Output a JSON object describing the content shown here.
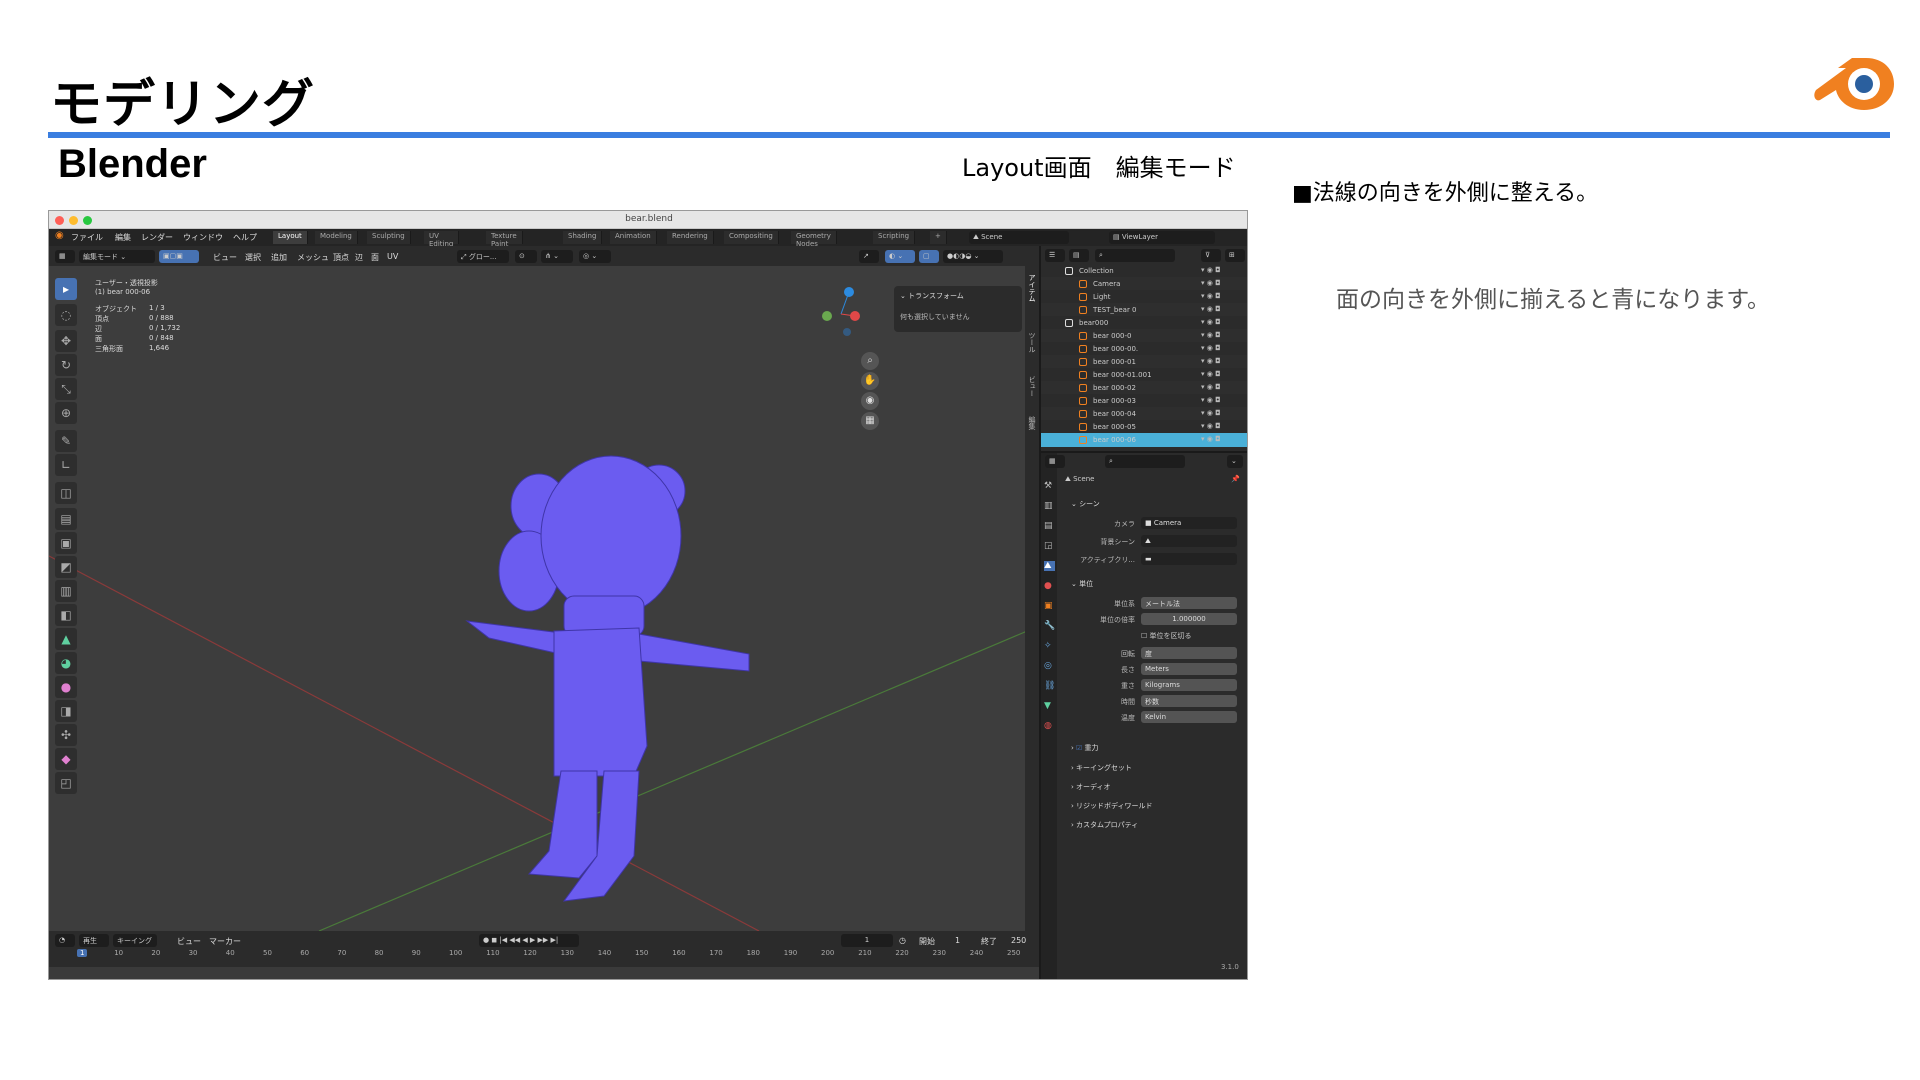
{
  "slide": {
    "title": "モデリング",
    "subtitle": "Blender",
    "caption": "Layout画面　編集モード",
    "note1": "■法線の向きを外側に整える。",
    "note2": "面の向きを外側に揃えると青になります。",
    "accent_color": "#3a7ee0",
    "logo_icon": "blender-logo-icon"
  },
  "window": {
    "title": "bear.blend",
    "menu": [
      "ファイル",
      "編集",
      "レンダー",
      "ウィンドウ",
      "ヘルプ"
    ],
    "workspaces": [
      "Layout",
      "Modeling",
      "Sculpting",
      "UV Editing",
      "Texture Paint",
      "Shading",
      "Animation",
      "Rendering",
      "Compositing",
      "Geometry Nodes",
      "Scripting"
    ],
    "active_workspace": "Layout",
    "scene": "Scene",
    "view_layer": "ViewLayer"
  },
  "viewport_header": {
    "mode": "編集モード",
    "menus": [
      "ビュー",
      "選択",
      "追加",
      "メッシュ",
      "頂点",
      "辺",
      "面",
      "UV"
    ],
    "orientation": "グロー...",
    "axes": [
      "X",
      "Y",
      "Z"
    ],
    "options": "オプション"
  },
  "stats": {
    "view": "ユーザー・透視投影",
    "object": "(1) bear 000-06",
    "rows": [
      {
        "label": "オブジェクト",
        "value": "1 / 3"
      },
      {
        "label": "頂点",
        "value": "0 / 888"
      },
      {
        "label": "辺",
        "value": "0 / 1,732"
      },
      {
        "label": "面",
        "value": "0 / 848"
      },
      {
        "label": "三角形面",
        "value": "1,646"
      }
    ]
  },
  "npanel": {
    "header": "トランスフォーム",
    "empty": "何も選択していません",
    "tabs": [
      "アイテム",
      "ツール",
      "ビュー",
      "編集"
    ]
  },
  "timeline": {
    "menus": [
      "再生",
      "キーイング",
      "ビュー",
      "マーカー"
    ],
    "current_frame": "1",
    "start_label": "開始",
    "start": "1",
    "end_label": "終了",
    "end": "250",
    "ticks": [
      "1",
      "10",
      "20",
      "30",
      "40",
      "50",
      "60",
      "70",
      "80",
      "90",
      "100",
      "110",
      "120",
      "130",
      "140",
      "150",
      "160",
      "170",
      "180",
      "190",
      "200",
      "210",
      "220",
      "230",
      "240",
      "250"
    ],
    "version": "3.1.0"
  },
  "outliner": {
    "rows": [
      {
        "name": "Collection",
        "depth": 1,
        "type": "collection",
        "selected": false
      },
      {
        "name": "Camera",
        "depth": 2,
        "type": "camera",
        "selected": false
      },
      {
        "name": "Light",
        "depth": 2,
        "type": "light",
        "selected": false
      },
      {
        "name": "TEST_bear 0",
        "depth": 2,
        "type": "mesh",
        "selected": false
      },
      {
        "name": "bear000",
        "depth": 1,
        "type": "collection",
        "selected": false
      },
      {
        "name": "bear 000-0",
        "depth": 2,
        "type": "mesh",
        "selected": false
      },
      {
        "name": "bear 000-00.",
        "depth": 2,
        "type": "mesh",
        "selected": false
      },
      {
        "name": "bear 000-01",
        "depth": 2,
        "type": "mesh",
        "selected": false
      },
      {
        "name": "bear 000-01.001",
        "depth": 2,
        "type": "mesh",
        "selected": false
      },
      {
        "name": "bear 000-02",
        "depth": 2,
        "type": "mesh",
        "selected": false
      },
      {
        "name": "bear 000-03",
        "depth": 2,
        "type": "mesh",
        "selected": false
      },
      {
        "name": "bear 000-04",
        "depth": 2,
        "type": "mesh",
        "selected": false
      },
      {
        "name": "bear 000-05",
        "depth": 2,
        "type": "mesh",
        "selected": false
      },
      {
        "name": "bear 000-06",
        "depth": 2,
        "type": "mesh",
        "selected": true
      }
    ]
  },
  "properties": {
    "scene_name": "Scene",
    "scene_section": "シーン",
    "camera_label": "カメラ",
    "camera_value": "Camera",
    "bg_scene_label": "背景シーン",
    "active_clip_label": "アクティブクリ...",
    "units_section": "単位",
    "unit_system_label": "単位系",
    "unit_system": "メートル法",
    "unit_scale_label": "単位の倍率",
    "unit_scale": "1.000000",
    "separate_units": "単位を区切る",
    "rotation_label": "回転",
    "rotation": "度",
    "length_label": "長さ",
    "length": "Meters",
    "mass_label": "重さ",
    "mass": "Kilograms",
    "time_label": "時間",
    "time": "秒数",
    "temp_label": "温度",
    "temp": "Kelvin",
    "collapsed": [
      "重力",
      "キーイングセット",
      "オーディオ",
      "リジッドボディワールド",
      "カスタムプロパティ"
    ]
  },
  "colors": {
    "mesh_front": "#6b5cf0",
    "mesh_wire": "#3f35a8",
    "selected_row": "#4ab0d8"
  }
}
